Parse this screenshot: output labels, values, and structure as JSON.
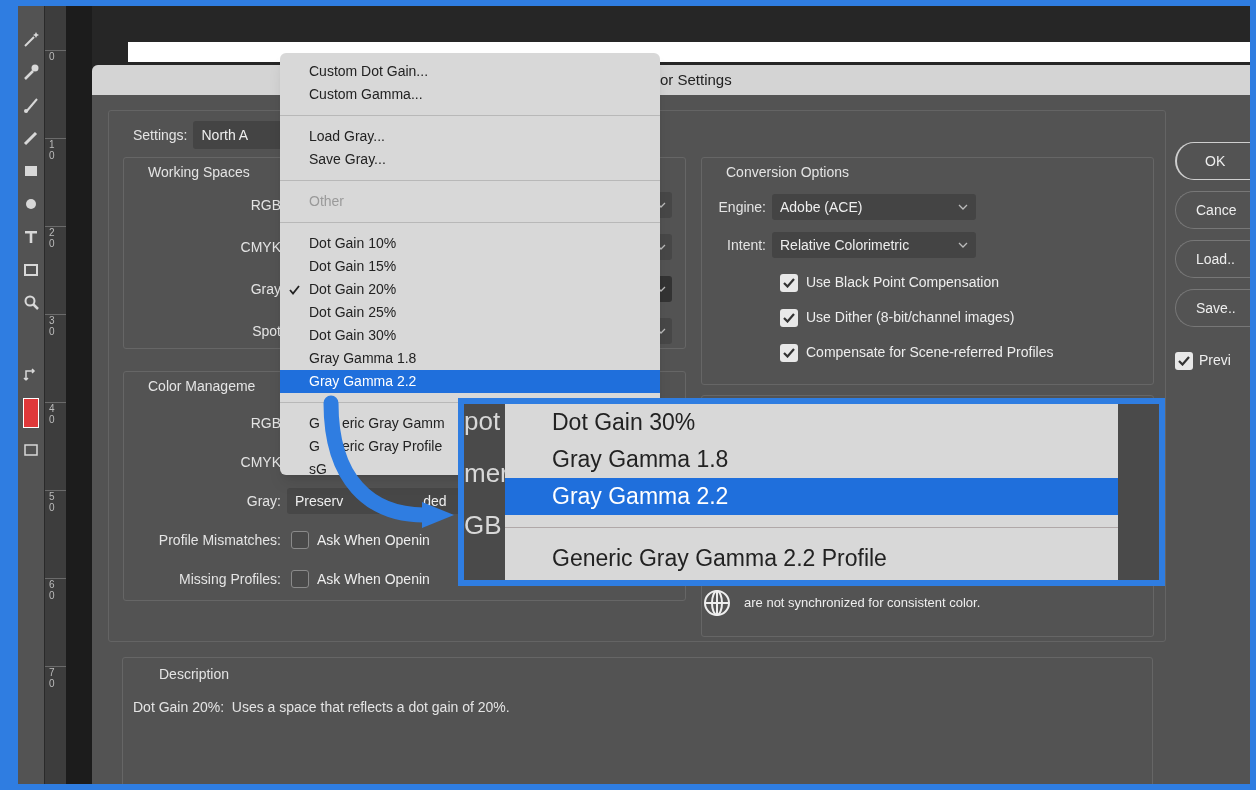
{
  "ruler": {
    "labels": [
      "0",
      "10",
      "20",
      "30",
      "40",
      "50",
      "60",
      "70"
    ]
  },
  "dialog": {
    "title": "or Settings",
    "settings": {
      "label": "Settings:",
      "value": "North A"
    },
    "working_spaces": {
      "title": "Working Spaces",
      "rows": [
        {
          "label": "RGB",
          "active": false
        },
        {
          "label": "CMYK",
          "active": false
        },
        {
          "label": "Gray",
          "active": true
        },
        {
          "label": "Spot",
          "active": false
        }
      ]
    },
    "color_management": {
      "title": "Color Manageme",
      "rows": [
        {
          "kind": "label",
          "label": "RGB"
        },
        {
          "kind": "label",
          "label": "CMYK"
        },
        {
          "kind": "select",
          "label": "Gray:",
          "value": "Preserv",
          "value_tail": "ded"
        },
        {
          "kind": "checkbox",
          "label": "Profile Mismatches:",
          "option": "Ask When Openin",
          "checked": false
        },
        {
          "kind": "checkbox",
          "label": "Missing Profiles:",
          "option": "Ask When Openin",
          "checked": false
        }
      ]
    },
    "conversion": {
      "title": "Conversion Options",
      "selects": [
        {
          "label": "Engine:",
          "value": "Adobe (ACE)"
        },
        {
          "label": "Intent:",
          "value": "Relative Colorimetric"
        }
      ],
      "options": [
        {
          "label": "Use Black Point Compensation",
          "checked": true
        },
        {
          "label": "Use Dither (8-bit/channel images)",
          "checked": true
        },
        {
          "label": "Compensate for Scene-referred Profiles",
          "checked": true
        }
      ]
    },
    "notice": "are not synchronized for consistent color.",
    "buttons": [
      "OK",
      "Cance",
      "Load..",
      "Save.."
    ],
    "preview": {
      "label": "Previ",
      "checked": true
    },
    "description": {
      "title": "Description",
      "text": "Dot Gain 20%:  Uses a space that reflects a dot gain of 20%."
    }
  },
  "menu": {
    "items": [
      {
        "kind": "item",
        "label": "Custom Dot Gain...",
        "checked": false,
        "highlighted": false
      },
      {
        "kind": "item",
        "label": "Custom Gamma...",
        "checked": false,
        "highlighted": false
      },
      {
        "kind": "separator"
      },
      {
        "kind": "item",
        "label": "Load Gray...",
        "checked": false,
        "highlighted": false
      },
      {
        "kind": "item",
        "label": "Save Gray...",
        "checked": false,
        "highlighted": false
      },
      {
        "kind": "separator"
      },
      {
        "kind": "header",
        "label": "Other"
      },
      {
        "kind": "separator"
      },
      {
        "kind": "item",
        "label": "Dot Gain 10%",
        "checked": false,
        "highlighted": false
      },
      {
        "kind": "item",
        "label": "Dot Gain 15%",
        "checked": false,
        "highlighted": false
      },
      {
        "kind": "item",
        "label": "Dot Gain 20%",
        "checked": true,
        "highlighted": false
      },
      {
        "kind": "item",
        "label": "Dot Gain 25%",
        "checked": false,
        "highlighted": false
      },
      {
        "kind": "item",
        "label": "Dot Gain 30%",
        "checked": false,
        "highlighted": false
      },
      {
        "kind": "item",
        "label": "Gray Gamma 1.8",
        "checked": false,
        "highlighted": false
      },
      {
        "kind": "item",
        "label": "Gray Gamma 2.2",
        "checked": false,
        "highlighted": true
      },
      {
        "kind": "separator"
      },
      {
        "kind": "item",
        "label": "G",
        "label_tail": "eric Gray Gamm",
        "checked": false,
        "highlighted": false
      },
      {
        "kind": "item",
        "label": "G",
        "label_tail": "eric Gray Profile",
        "checked": false,
        "highlighted": false
      },
      {
        "kind": "item",
        "label": "sG",
        "checked": false,
        "highlighted": false
      }
    ]
  },
  "zoom_inset": {
    "fragments": [
      "pot",
      "mer",
      "GB"
    ],
    "items": [
      {
        "kind": "item",
        "label": "Dot Gain 30%",
        "highlighted": false
      },
      {
        "kind": "item",
        "label": "Gray Gamma 1.8",
        "highlighted": false
      },
      {
        "kind": "item",
        "label": "Gray Gamma 2.2",
        "highlighted": true
      },
      {
        "kind": "separator"
      },
      {
        "kind": "item",
        "label": "Generic Gray Gamma 2.2 Profile",
        "highlighted": false
      }
    ]
  }
}
